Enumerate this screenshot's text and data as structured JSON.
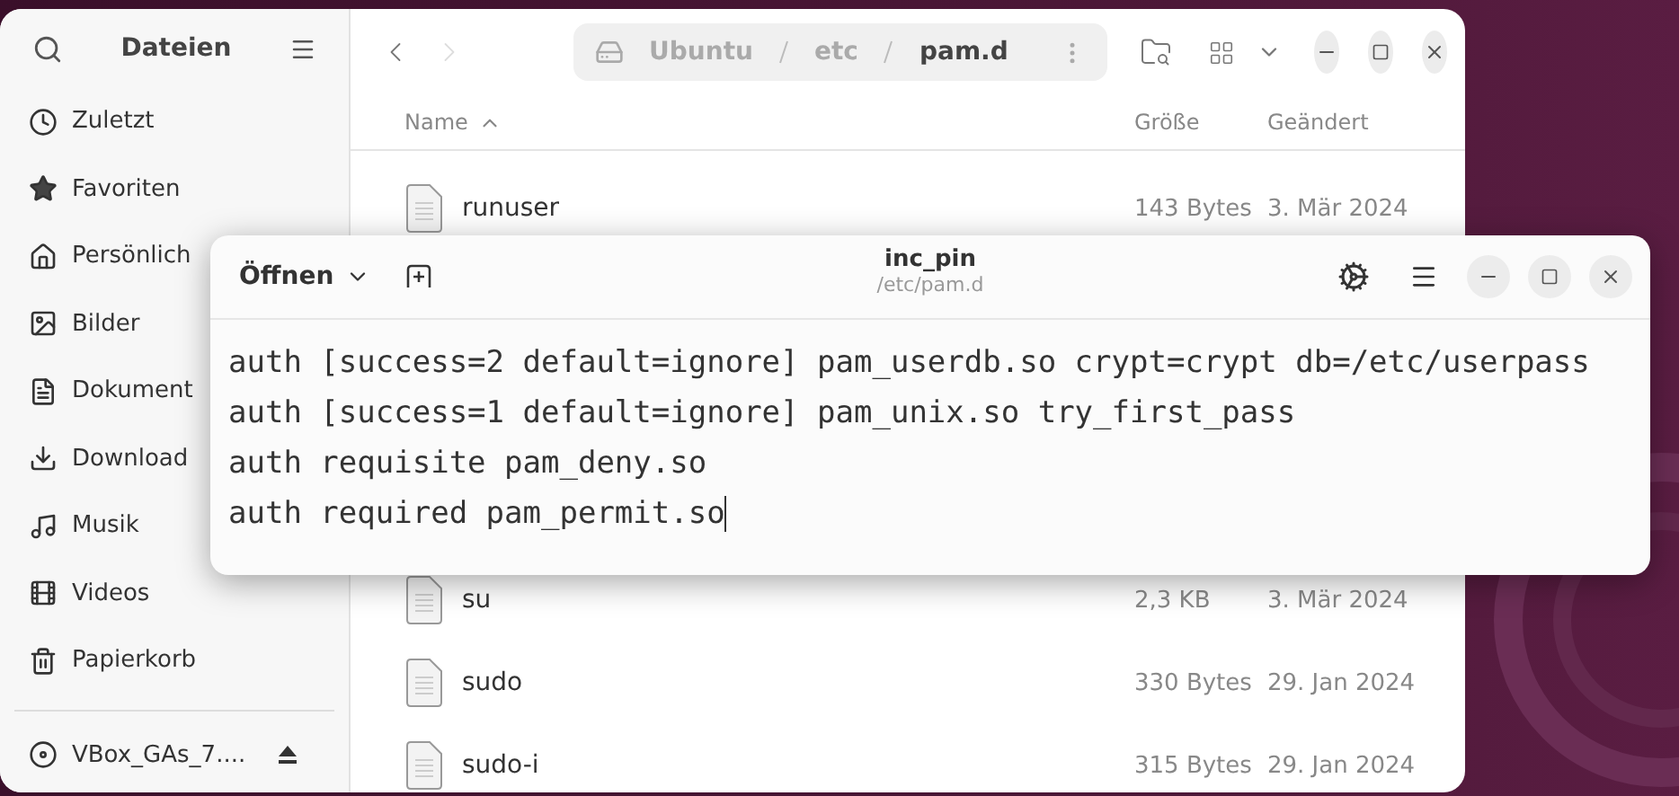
{
  "file_manager": {
    "sidebar": {
      "title": "Dateien",
      "items": [
        {
          "kind": "clock",
          "label": "Zuletzt"
        },
        {
          "kind": "star",
          "label": "Favoriten"
        },
        {
          "kind": "home",
          "label": "Persönlich"
        },
        {
          "kind": "image",
          "label": "Bilder"
        },
        {
          "kind": "document",
          "label": "Dokument"
        },
        {
          "kind": "download",
          "label": "Download"
        },
        {
          "kind": "music",
          "label": "Musik"
        },
        {
          "kind": "film",
          "label": "Videos"
        },
        {
          "kind": "trash",
          "label": "Papierkorb"
        }
      ],
      "devices": [
        {
          "label": "VBox_GAs_7...."
        }
      ]
    },
    "path": [
      "Ubuntu",
      "etc",
      "pam.d"
    ],
    "columns": {
      "name": "Name",
      "size": "Größe",
      "modified": "Geändert"
    },
    "rows": [
      {
        "name": "runuser",
        "size": "143 Bytes",
        "modified": "3. Mär 2024"
      },
      {
        "name": "su",
        "size": "2,3 KB",
        "modified": "3. Mär 2024"
      },
      {
        "name": "sudo",
        "size": "330 Bytes",
        "modified": "29. Jan 2024"
      },
      {
        "name": "sudo-i",
        "size": "315 Bytes",
        "modified": "29. Jan 2024"
      }
    ]
  },
  "editor": {
    "open_label": "Öffnen",
    "title": "inc_pin",
    "subtitle": "/etc/pam.d",
    "lines": [
      "auth [success=2 default=ignore] pam_userdb.so crypt=crypt db=/etc/userpass",
      "auth [success=1 default=ignore] pam_unix.so try_first_pass",
      "auth requisite pam_deny.so",
      "auth required pam_permit.so"
    ]
  }
}
